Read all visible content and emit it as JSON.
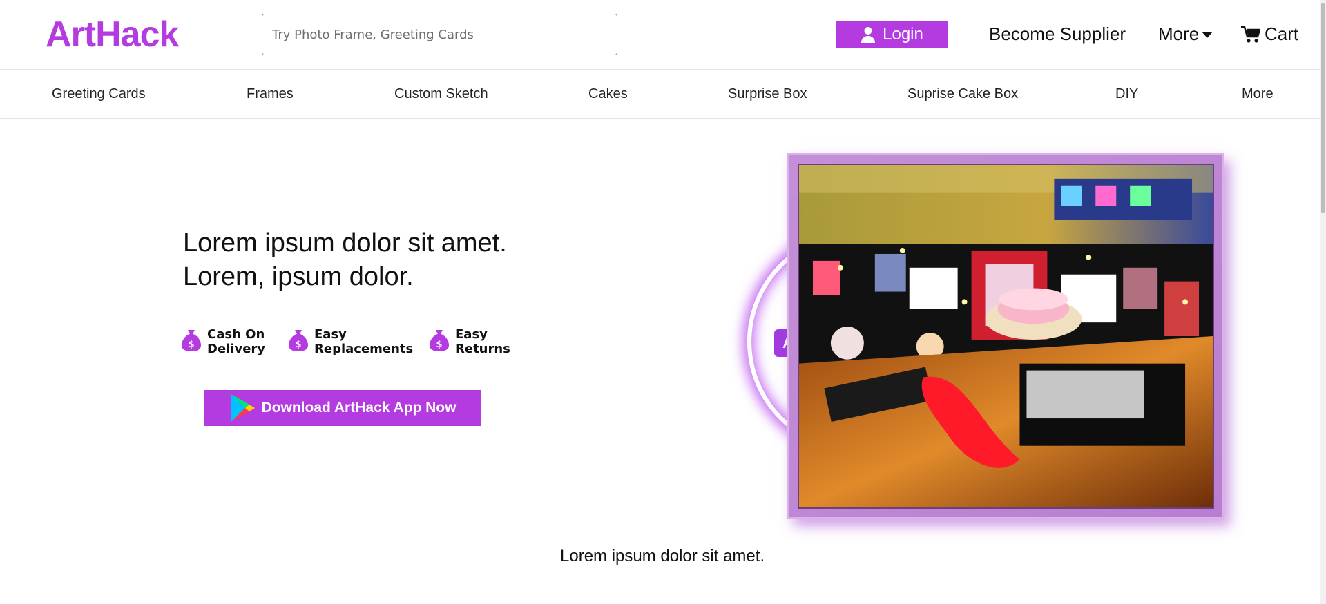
{
  "brand": {
    "name": "ArtHack",
    "accent_color": "#b33be0"
  },
  "search": {
    "placeholder": "Try Photo Frame, Greeting Cards",
    "value": ""
  },
  "header": {
    "login_label": "Login",
    "login_icon": "user-icon",
    "supplier_label": "Become Supplier",
    "more_label": "More",
    "cart_label": "Cart",
    "cart_icon": "cart-icon"
  },
  "categories": [
    "Greeting Cards",
    "Frames",
    "Custom Sketch",
    "Cakes",
    "Surprise Box",
    "Suprise Cake Box",
    "DIY",
    "More"
  ],
  "hero": {
    "title_line1": "Lorem ipsum dolor sit amet.",
    "title_line2": "Lorem, ipsum dolor.",
    "features": [
      {
        "icon": "money-bag-icon",
        "line1": "Cash On",
        "line2": "Delivery"
      },
      {
        "icon": "money-bag-icon",
        "line1": "Easy",
        "line2": "Replacements"
      },
      {
        "icon": "money-bag-icon",
        "line1": "Easy",
        "line2": "Returns"
      }
    ],
    "download_label": "Download ArtHack App Now",
    "download_icon": "google-play-icon",
    "badge_letter": "A"
  },
  "section": {
    "title": "Lorem ipsum dolor sit amet."
  }
}
